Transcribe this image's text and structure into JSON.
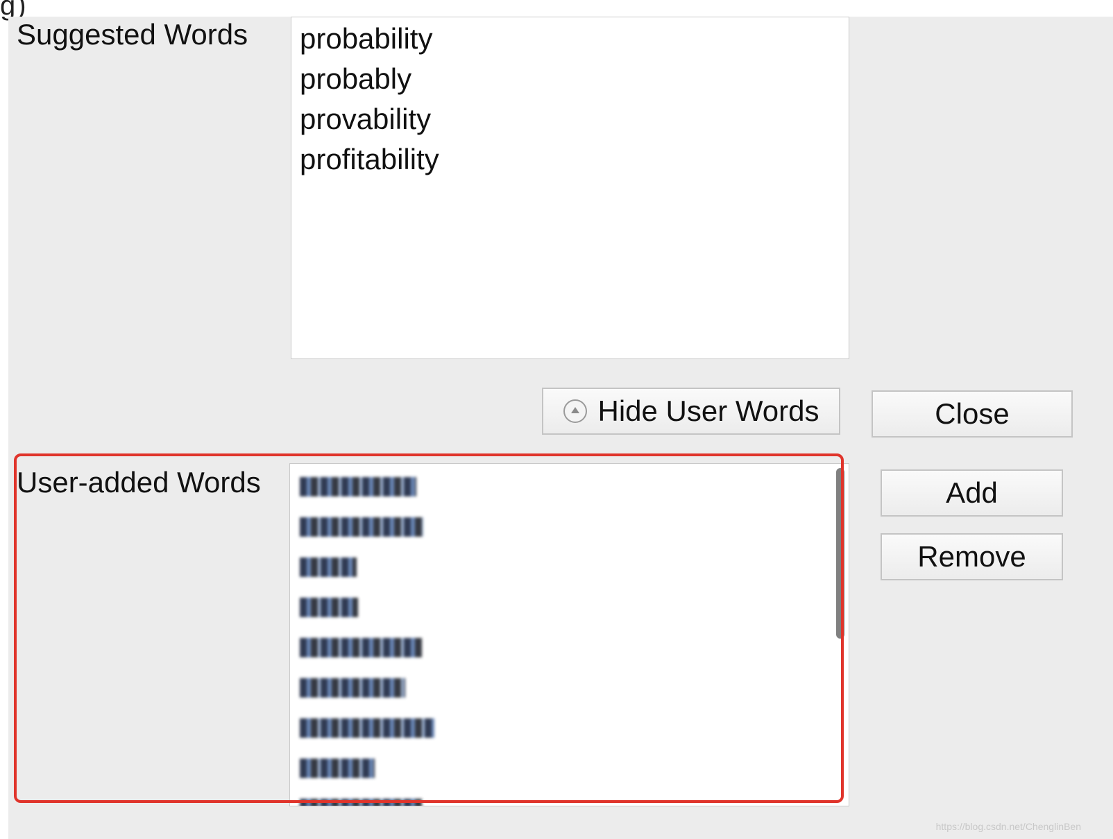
{
  "top_cut_text": "g)",
  "suggested": {
    "label": "Suggested Words",
    "words": [
      "probability",
      "probably",
      "provability",
      "profitability"
    ]
  },
  "user_added": {
    "label": "User-added Words",
    "obscured_count": 9
  },
  "buttons": {
    "hide_user_words": "Hide User Words",
    "close": "Close",
    "add": "Add",
    "remove": "Remove"
  },
  "watermark": "https://blog.csdn.net/ChenglinBen",
  "colors": {
    "panel_bg": "#ececec",
    "highlight": "#e0342b"
  },
  "icons": {
    "hide_user_words": "disclosure-up-icon"
  }
}
